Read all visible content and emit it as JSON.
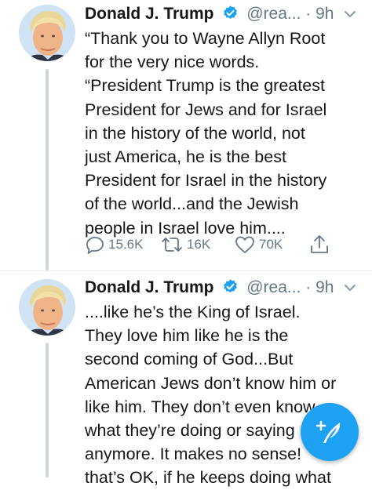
{
  "tweets": [
    {
      "author": {
        "name": "Donald J. Trump",
        "handle": "@rea...",
        "separator": "·",
        "time": "9h"
      },
      "text": "“Thank you to Wayne Allyn Root\nfor the very nice words.\n“President Trump is the greatest\nPresident for Jews and for Israel\nin the history of the world, not\njust America, he is the best\nPresident for Israel in the history\nof the world...and the Jewish\npeople in Israel love him....",
      "stats": {
        "replies": "15.6K",
        "retweets": "16K",
        "likes": "70K"
      }
    },
    {
      "author": {
        "name": "Donald J. Trump",
        "handle": "@rea...",
        "separator": "·",
        "time": "9h"
      },
      "text": "....like he’s the King of Israel.\nThey love him like he is the\nsecond coming of God...But\nAmerican Jews don’t know him or\nlike him. They don’t even know\nwhat they’re doing or saying\nanymore. It makes no sense!\nthat’s OK, if he keeps doing what"
    }
  ],
  "icons": {
    "verified": "verified-badge-icon",
    "caret": "chevron-down-icon",
    "reply": "reply-icon",
    "retweet": "retweet-icon",
    "like": "heart-icon",
    "share": "share-icon",
    "compose": "compose-feather-icon"
  },
  "colors": {
    "brand": "#1da1f2",
    "meta": "#657786",
    "text": "#14171a",
    "thread": "#ccd6dd"
  }
}
